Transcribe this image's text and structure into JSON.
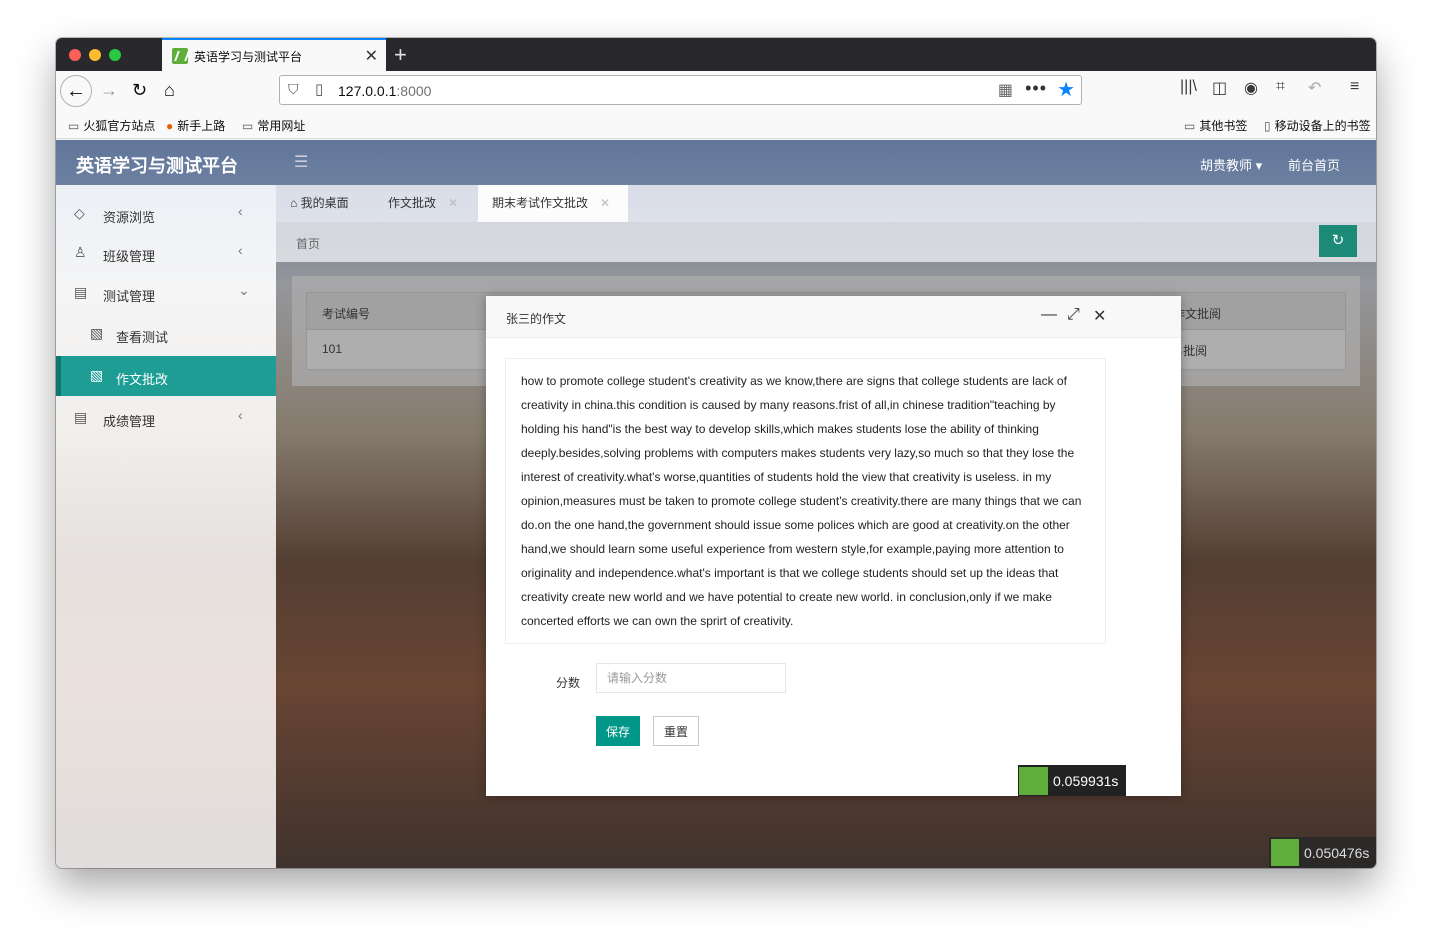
{
  "browser": {
    "tab_title": "英语学习与测试平台",
    "tab_close": "✕",
    "new_tab": "+",
    "url_host": "127.0.0.1",
    "url_port": ":8000",
    "bookmarks": [
      "火狐官方站点",
      "新手上路",
      "常用网址"
    ],
    "bookmarks_right": [
      "其他书签",
      "移动设备上的书签"
    ]
  },
  "app": {
    "title": "英语学习与测试平台",
    "user": "胡贵教师",
    "front_link": "前台首页"
  },
  "sidebar": {
    "items": [
      {
        "label": "资源浏览",
        "icon": "diamond-icon"
      },
      {
        "label": "班级管理",
        "icon": "user-icon"
      },
      {
        "label": "测试管理",
        "icon": "test-icon"
      },
      {
        "label": "查看测试",
        "icon": "doc-edit-icon"
      },
      {
        "label": "作文批改",
        "icon": "doc-edit-icon"
      },
      {
        "label": "成绩管理",
        "icon": "test-icon"
      }
    ]
  },
  "page_tabs": {
    "home": "我的桌面",
    "tab1": "作文批改",
    "tab2": "期末考试作文批改"
  },
  "breadcrumb": "首页",
  "table": {
    "headers": [
      "考试编号",
      "作文批阅"
    ],
    "row": {
      "id": "101",
      "action": "批阅"
    }
  },
  "modal": {
    "title": "张三的作文",
    "essay": "how to promote college student's creativity as we know,there are signs that college students are lack of creativity in china.this condition is caused by many reasons.frist of all,in chinese tradition\"teaching by holding his hand\"is the best way to develop skills,which makes students lose the ability of thinking deeply.besides,solving problems with computers makes students very lazy,so much so that they lose the interest of creativity.what's worse,quantities of students hold the view that creativity is useless. in my opinion,measures must be taken to promote college student's creativity.there are many things that we can do.on the one hand,the government should issue some polices which are good at creativity.on the other hand,we should learn some useful experience from western style,for example,paying more attention to originality and independence.what's important is that we college students should set up the ideas that creativity create new world and we have potential to create new world.        in conclusion,only if we make concerted efforts we can own the sprirt of creativity.",
    "score_label": "分数",
    "score_placeholder": "请输入分数",
    "save": "保存",
    "reset": "重置"
  },
  "perf": {
    "modal_time": "0.059931s",
    "page_time": "0.050476s"
  },
  "colors": {
    "accent": "#009688",
    "sidebar_active": "#1d9d94",
    "browser_blue": "#0a84ff"
  }
}
